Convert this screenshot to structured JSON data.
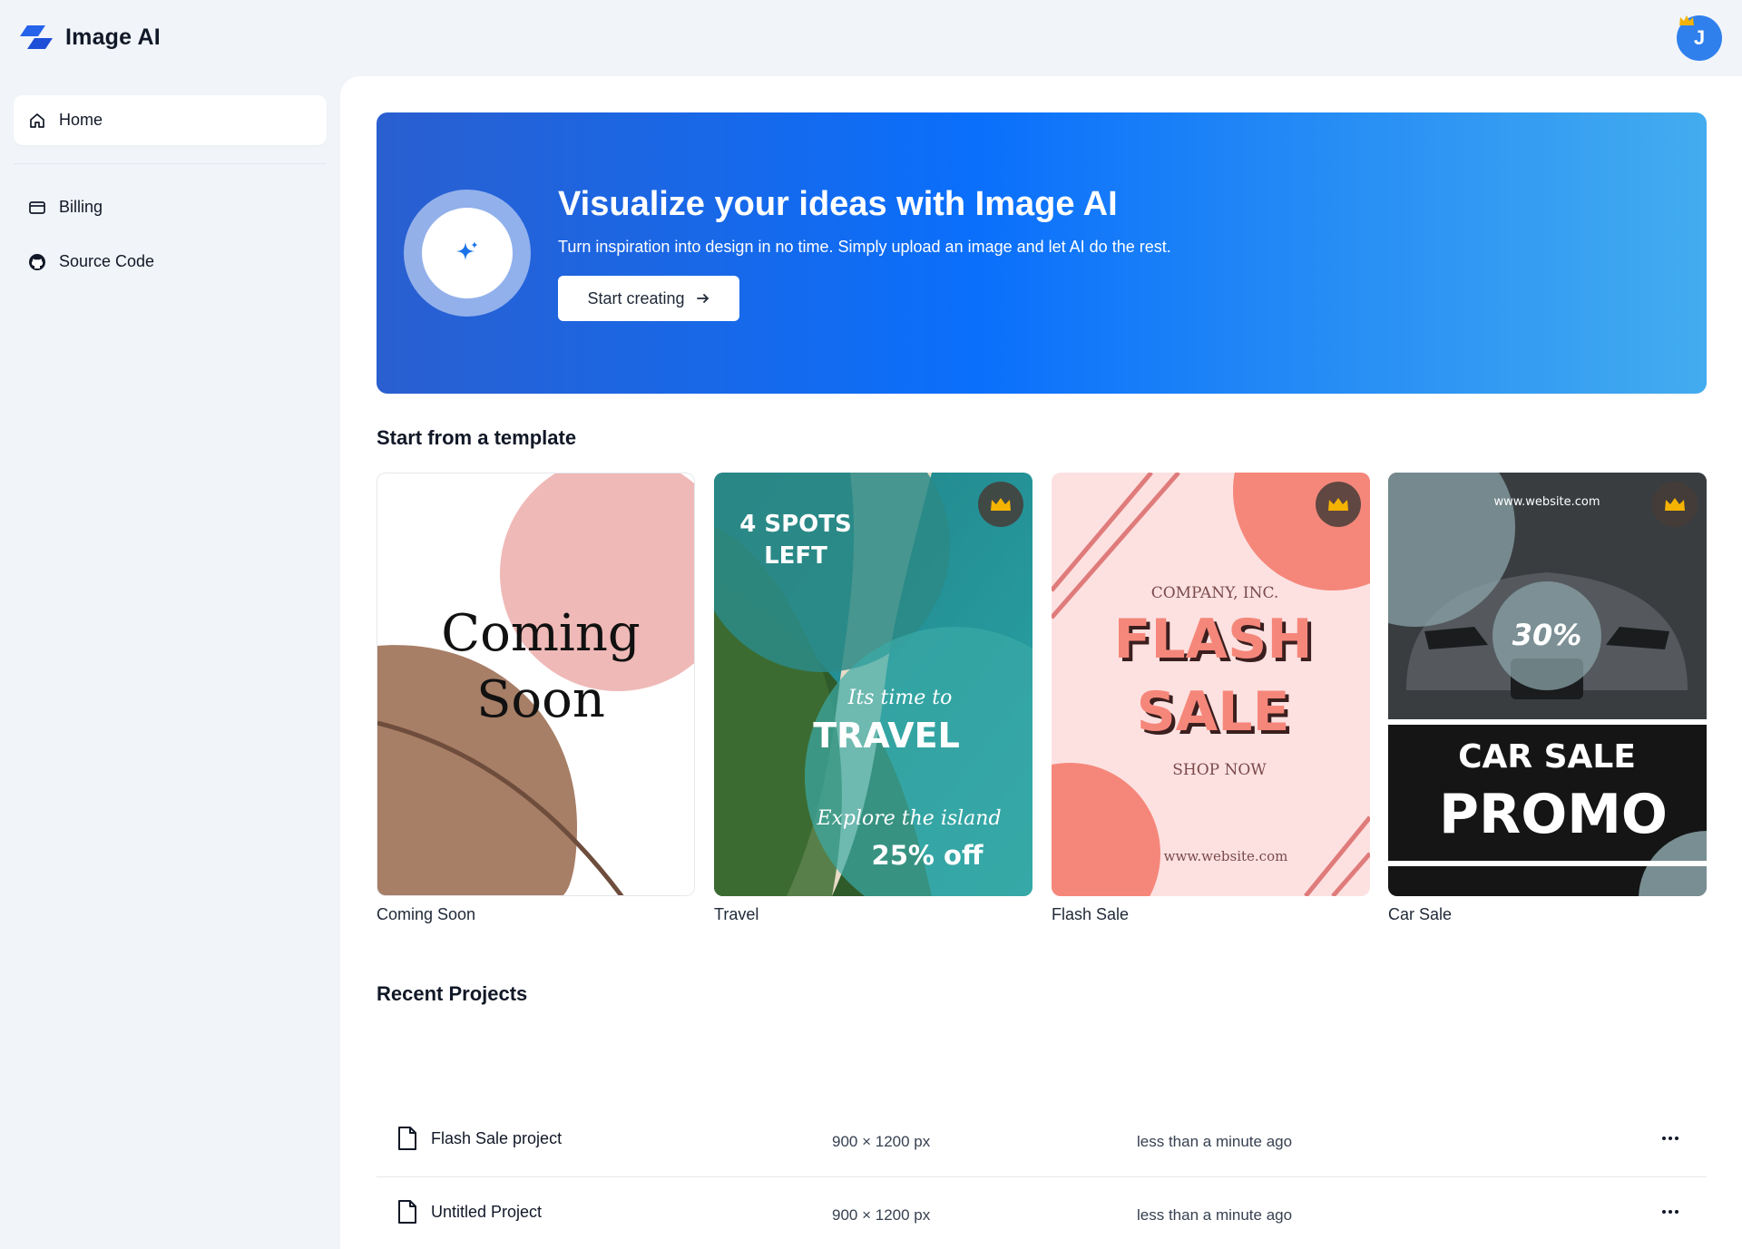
{
  "app": {
    "title": "Image AI"
  },
  "user": {
    "initial": "J"
  },
  "sidebar": {
    "items": [
      {
        "label": "Home",
        "icon": "home-icon",
        "active": true
      },
      {
        "label": "Billing",
        "icon": "credit-card-icon",
        "active": false
      },
      {
        "label": "Source Code",
        "icon": "github-icon",
        "active": false
      }
    ]
  },
  "hero": {
    "title": "Visualize your ideas with Image AI",
    "subtitle": "Turn inspiration into design in no time. Simply upload an image and let AI do the rest.",
    "button_label": "Start creating",
    "gradient": [
      "#2a5fd0",
      "#0a6ffb",
      "#43acef"
    ]
  },
  "templates": {
    "title": "Start from a template",
    "items": [
      {
        "label": "Coming Soon",
        "premium": false,
        "lines": [
          "Coming",
          "Soon"
        ]
      },
      {
        "label": "Travel",
        "premium": true,
        "lines": [
          "4 SPOTS",
          "LEFT",
          "Its time to",
          "TRAVEL",
          "Explore the island",
          "25% off"
        ]
      },
      {
        "label": "Flash Sale",
        "premium": true,
        "lines": [
          "COMPANY, INC.",
          "FLASH",
          "SALE",
          "SHOP NOW",
          "www.website.com"
        ]
      },
      {
        "label": "Car Sale",
        "premium": true,
        "lines": [
          "www.website.com",
          "30%",
          "CAR SALE",
          "PROMO"
        ]
      }
    ]
  },
  "recent": {
    "title": "Recent Projects",
    "rows": [
      {
        "name": "Flash Sale project",
        "size": "900 × 1200 px",
        "time": "less than a minute ago"
      },
      {
        "name": "Untitled Project",
        "size": "900 × 1200 px",
        "time": "less than a minute ago"
      }
    ]
  },
  "colors": {
    "accent": "#2f80ed",
    "premium_crown": "#f5b301"
  }
}
